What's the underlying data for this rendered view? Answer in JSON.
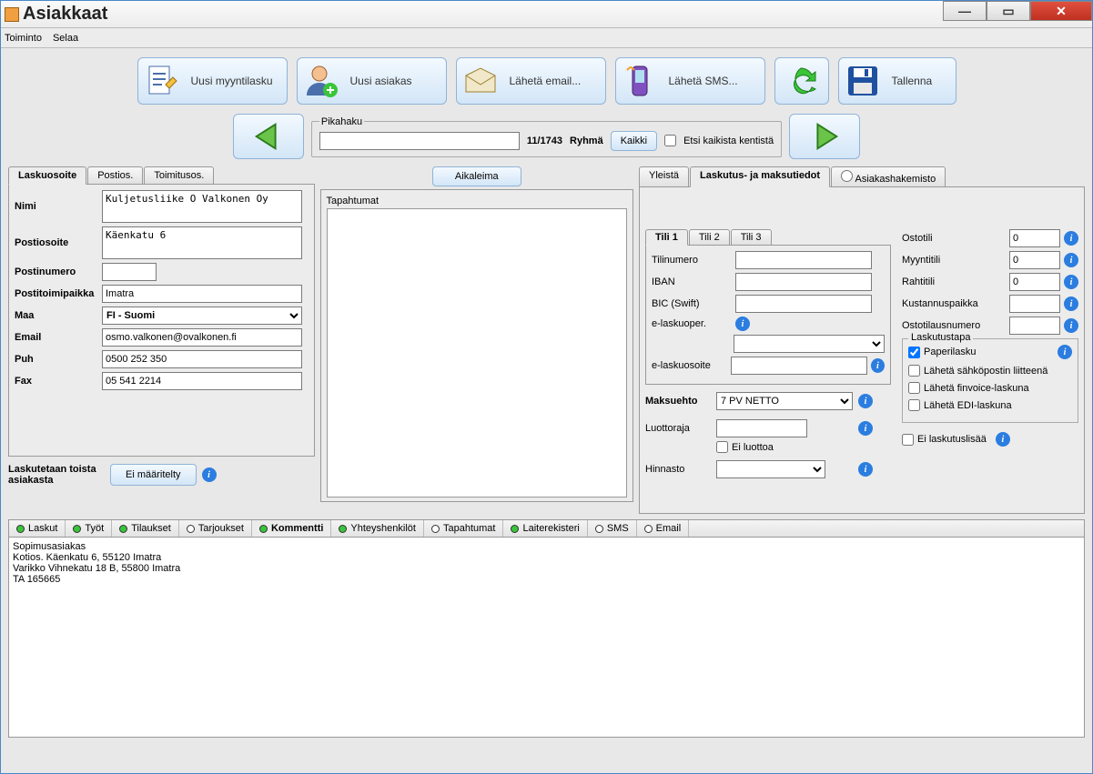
{
  "window": {
    "title": "Asiakkaat"
  },
  "menu": {
    "toiminto": "Toiminto",
    "selaa": "Selaa"
  },
  "toolbar": {
    "uusi_lasku": "Uusi myyntilasku",
    "uusi_asiakas": "Uusi asiakas",
    "email": "Lähetä email...",
    "sms": "Lähetä SMS...",
    "refresh": "",
    "tallenna": "Tallenna"
  },
  "quicksearch": {
    "legend": "Pikahaku",
    "value": "",
    "counter": "11/1743",
    "ryhma_label": "Ryhmä",
    "kaikki": "Kaikki",
    "search_all": "Etsi kaikista kentistä"
  },
  "address_tabs": {
    "lasku": "Laskuosoite",
    "postios": "Postios.",
    "toimitus": "Toimitusos."
  },
  "address": {
    "nimi_label": "Nimi",
    "nimi": "Kuljetusliike O Valkonen Oy",
    "postiosoite_label": "Postiosoite",
    "postiosoite": "Käenkatu 6",
    "postinumero_label": "Postinumero",
    "postinumero": "",
    "postitoimipaikka_label": "Postitoimipaikka",
    "postitoimipaikka": "Imatra",
    "maa_label": "Maa",
    "maa": "FI - Suomi",
    "email_label": "Email",
    "email": "osmo.valkonen@ovalkonen.fi",
    "puh_label": "Puh",
    "puh": "0500 252 350",
    "fax_label": "Fax",
    "fax": "05 541 2214",
    "laskutetaan_label": "Laskutetaan toista asiakasta",
    "ei_maaritelty": "Ei määritelty"
  },
  "mid": {
    "aikaleima": "Aikaleima",
    "tapahtumat": "Tapahtumat"
  },
  "right_tabs": {
    "yleista": "Yleistä",
    "laskutus": "Laskutus- ja maksutiedot",
    "hakemisto": "Asiakashakemisto"
  },
  "acct_tabs": {
    "t1": "Tili 1",
    "t2": "Tili 2",
    "t3": "Tili 3"
  },
  "acct": {
    "tilinumero_label": "Tilinumero",
    "tilinumero": "",
    "iban_label": "IBAN",
    "iban": "",
    "bic_label": "BIC (Swift)",
    "bic": "",
    "elaskuoper_label": "e-laskuoper.",
    "elaskuoper": "",
    "elaskuosoite_label": "e-laskuosoite",
    "elaskuosoite": "",
    "maksuehto_label": "Maksuehto",
    "maksuehto": "7 PV NETTO",
    "luottoraja_label": "Luottoraja",
    "luottoraja": "",
    "ei_luottoa": "Ei luottoa",
    "hinnasto_label": "Hinnasto",
    "hinnasto": ""
  },
  "rightsub": {
    "ostotili_label": "Ostotili",
    "ostotili": "0",
    "myyntitili_label": "Myyntitili",
    "myyntitili": "0",
    "rahtitili_label": "Rahtitili",
    "rahtitili": "0",
    "kustannuspaikka_label": "Kustannuspaikka",
    "kustannuspaikka": "",
    "ostotilausnumero_label": "Ostotilausnumero",
    "ostotilausnumero": "",
    "laskutustapa_legend": "Laskutustapa",
    "paperilasku": "Paperilasku",
    "sahkoposti": "Lähetä sähköpostin liitteenä",
    "finvoice": "Lähetä finvoice-laskuna",
    "edi": "Lähetä EDI-laskuna",
    "ei_laskutuslisaa": "Ei laskutuslisää"
  },
  "bottom_tabs": {
    "laskut": "Laskut",
    "tyot": "Työt",
    "tilaukset": "Tilaukset",
    "tarjoukset": "Tarjoukset",
    "kommentti": "Kommentti",
    "yhteyshenkilot": "Yhteyshenkilöt",
    "tapahtumat": "Tapahtumat",
    "laiterekisteri": "Laiterekisteri",
    "sms": "SMS",
    "email": "Email"
  },
  "comment": "Sopimusasiakas\nKotios. Käenkatu 6, 55120 Imatra\nVarikko Vihnekatu 18 B, 55800 Imatra\nTA 165665"
}
